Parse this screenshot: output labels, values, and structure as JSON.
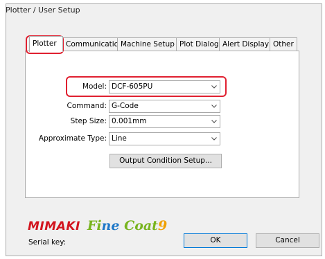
{
  "window": {
    "title": "Plotter / User Setup"
  },
  "tabs": [
    {
      "label": "Plotter",
      "active": true
    },
    {
      "label": "Communication",
      "active": false
    },
    {
      "label": "Machine Setup",
      "active": false
    },
    {
      "label": "Plot Dialog",
      "active": false
    },
    {
      "label": "Alert Display",
      "active": false
    },
    {
      "label": "Other",
      "active": false
    }
  ],
  "fields": {
    "model": {
      "label": "Model:",
      "value": "DCF-605PU"
    },
    "command": {
      "label": "Command:",
      "value": "G-Code"
    },
    "step_size": {
      "label": "Step Size:",
      "value": "0.001mm"
    },
    "approximate_type": {
      "label": "Approximate Type:",
      "value": "Line"
    }
  },
  "output_condition_button": "Output Condition Setup...",
  "branding": {
    "maker": "MIMAKI",
    "product": "FineCoat",
    "version": "9"
  },
  "serial_key": {
    "label": "Serial key:"
  },
  "buttons": {
    "ok": "OK",
    "cancel": "Cancel"
  },
  "colors": {
    "highlight": "#e02030",
    "mimaki_red": "#d2141e",
    "finecoat_green": "#78b41e",
    "finecoat_blue": "#1e78c8",
    "finecoat_orange": "#f0a000"
  }
}
